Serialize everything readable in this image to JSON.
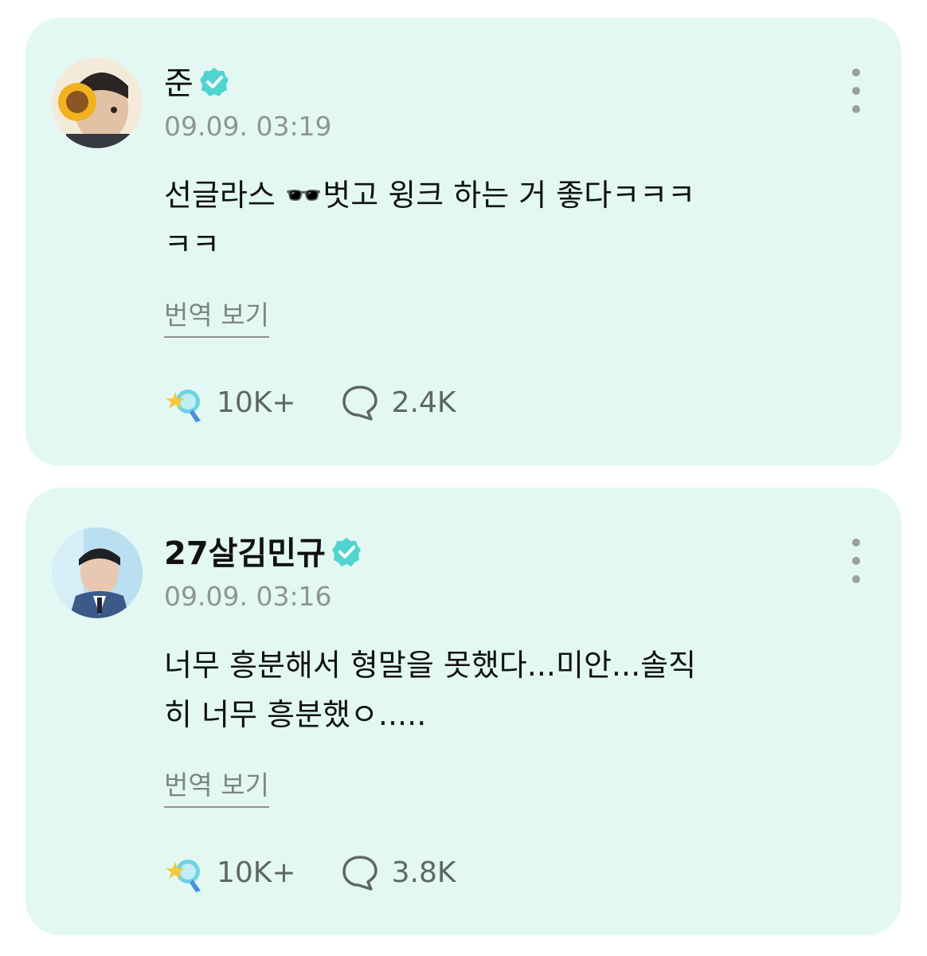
{
  "posts": [
    {
      "username": "준",
      "timestamp": "09.09. 03:19",
      "body": "선글라스 🕶️벗고 윙크 하는 거 좋다ㅋㅋㅋ\nㅋㅋ",
      "translate_label": "번역 보기",
      "likes": "10K+",
      "comments": "2.4K"
    },
    {
      "username": "27살김민규",
      "timestamp": "09.09. 03:16",
      "body": "너무 흥분해서 형말을 못했다...미안...솔직\n히 너무 흥분했ㅇ.....",
      "translate_label": "번역 보기",
      "likes": "10K+",
      "comments": "3.8K"
    }
  ],
  "colors": {
    "card_bg": "#e3f8f3",
    "verified_badge": "#4fd4cf",
    "timestamp": "#8f9494"
  },
  "icons": {
    "verified": "verified-badge-icon",
    "like": "star-lightstick-icon",
    "comment": "speech-bubble-icon",
    "more": "more-vertical-icon"
  }
}
